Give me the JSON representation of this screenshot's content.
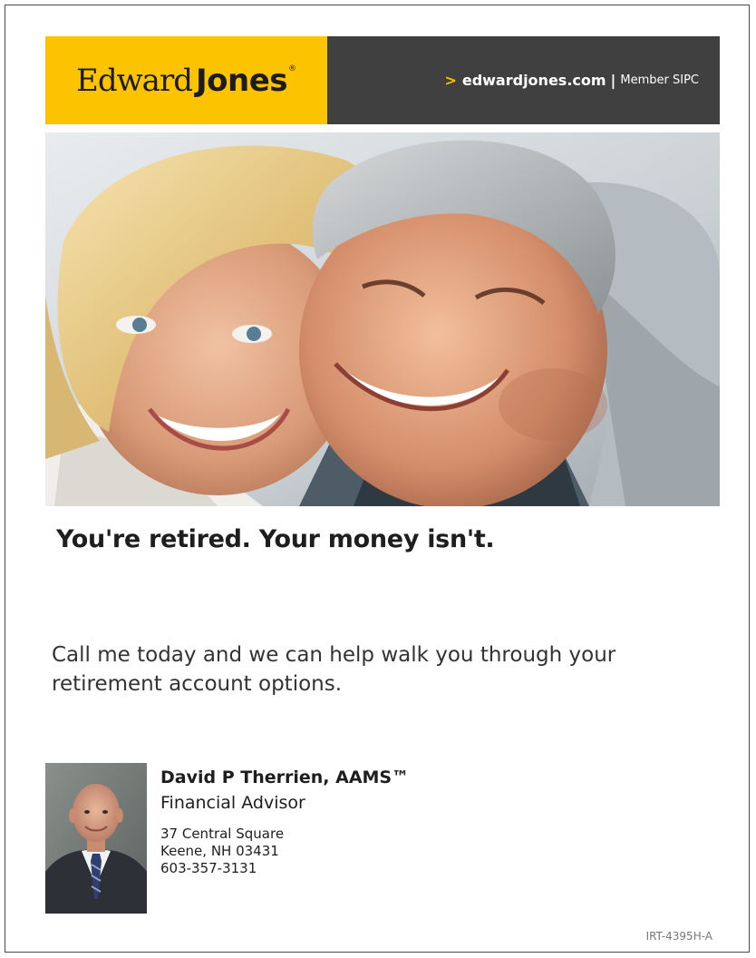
{
  "header": {
    "logo": {
      "first": "Edward",
      "last": "Jones",
      "registered": "®"
    },
    "link": {
      "arrow": ">",
      "site": "edwardjones.com",
      "separator": "|",
      "member": "Member SIPC"
    }
  },
  "hero": {
    "subject": "smiling-couple-photo"
  },
  "headline": "You're retired. Your money isn't.",
  "body_copy": "Call me today and we can help walk you through your retirement account options.",
  "advisor": {
    "photo": "advisor-portrait",
    "name": "David P Therrien, AAMS™",
    "title": "Financial Advisor",
    "address_line1": "37 Central Square",
    "address_line2": "Keene, NH 03431",
    "phone": "603-357-3131"
  },
  "ad_code": "IRT-4395H-A",
  "colors": {
    "brand_yellow": "#fcc300",
    "header_dark": "#404040",
    "text": "#1e1e1e"
  }
}
